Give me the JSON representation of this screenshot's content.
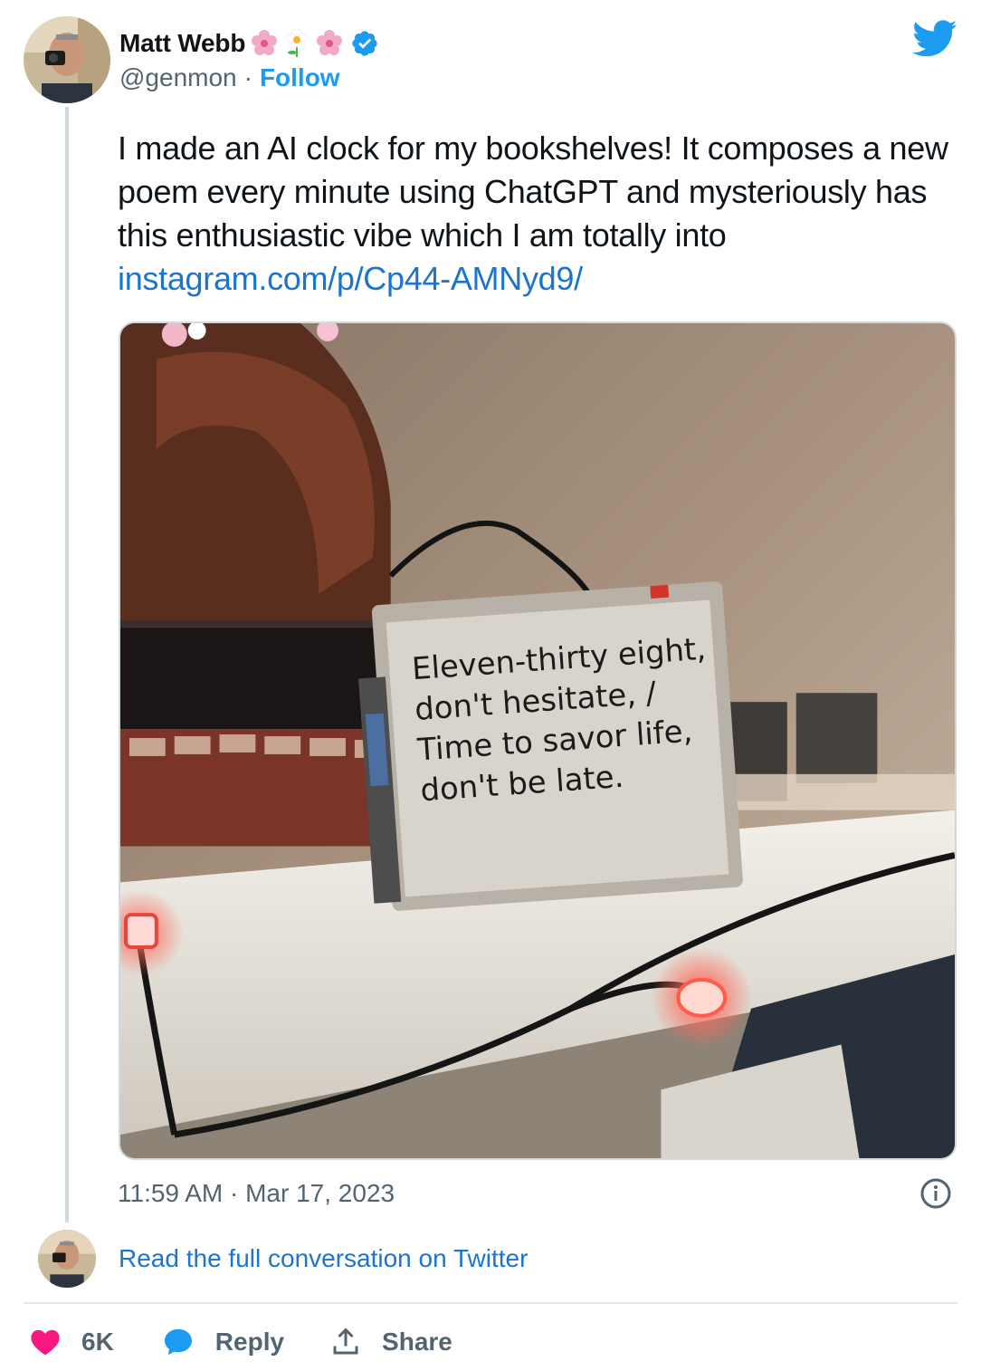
{
  "author": {
    "name": "Matt Webb",
    "handle": "@genmon",
    "separator": "·",
    "follow_label": "Follow",
    "name_emojis": [
      "cherry-blossom",
      "blossom",
      "cherry-blossom"
    ],
    "verified": true
  },
  "tweet": {
    "text": "I made an AI clock for my bookshelves! It composes a new poem every minute using ChatGPT and mysteriously has this enthusiastic vibe which I am totally into ",
    "link": "instagram.com/p/Cp44-AMNyd9/",
    "timestamp": "11:59 AM · Mar 17, 2023"
  },
  "media": {
    "screen_lines": [
      "Eleven-thirty eight,",
      "don't hesitate, /",
      "Time to savor life,",
      "don't be late."
    ]
  },
  "footer": {
    "read_more": "Read the full conversation on Twitter",
    "likes": "6K",
    "reply_label": "Reply",
    "share_label": "Share"
  },
  "colors": {
    "accent": "#1d9bf0",
    "link": "#1b75d0",
    "like": "#f91880",
    "muted": "#536471"
  },
  "icons": [
    "twitter-bird-icon",
    "verified-badge-icon",
    "info-icon",
    "heart-icon",
    "reply-bubble-icon",
    "share-icon"
  ]
}
